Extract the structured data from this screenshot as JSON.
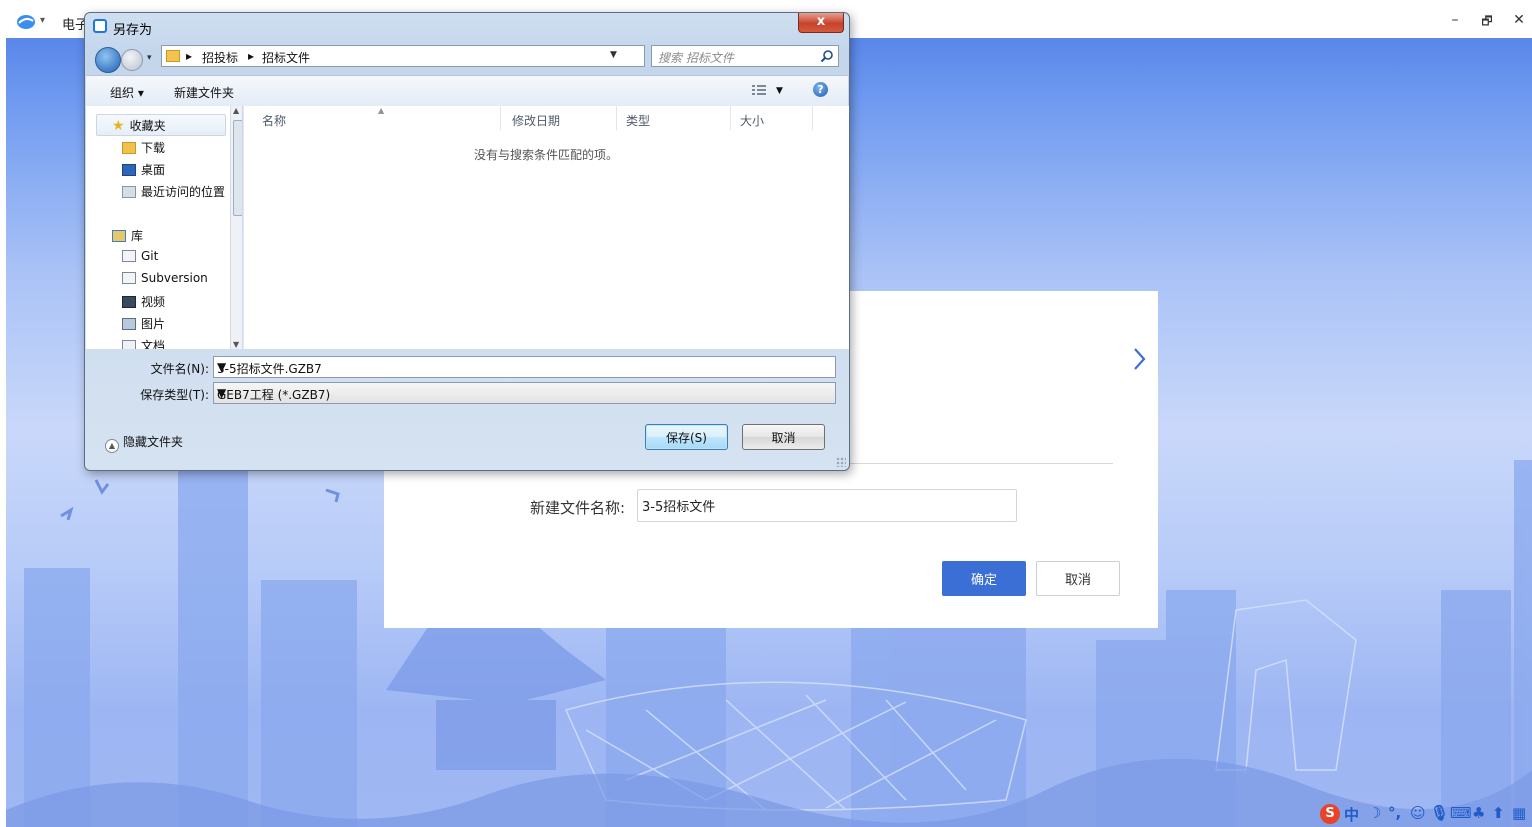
{
  "app": {
    "title": "电子",
    "window_controls": {
      "minimize": "–",
      "restore": "🗗",
      "close": "✕"
    }
  },
  "panel": {
    "next_icon": "chevron-right-icon",
    "new_file_label": "新建文件名称:",
    "new_file_value": "3-5招标文件",
    "ok_label": "确定",
    "cancel_label": "取消",
    "accent_color": "#3b6fd6"
  },
  "dialog": {
    "title": "另存为",
    "close_label": "x",
    "breadcrumb": [
      "招投标",
      "招标文件"
    ],
    "search_placeholder": "搜索 招标文件",
    "toolbar": {
      "organize": "组织 ▾",
      "new_folder": "新建文件夹",
      "help": "?"
    },
    "nav": {
      "favorites_label": "收藏夹",
      "favorites": [
        "下载",
        "桌面",
        "最近访问的位置"
      ],
      "libraries_label": "库",
      "libraries": [
        "Git",
        "Subversion",
        "视频",
        "图片",
        "文档"
      ]
    },
    "columns": [
      "名称",
      "修改日期",
      "类型",
      "大小"
    ],
    "empty_message": "没有与搜索条件匹配的项。",
    "filename_label": "文件名(N):",
    "filename_value": "3-5招标文件.GZB7",
    "filetype_label": "保存类型(T):",
    "filetype_value": "GEB7工程 (*.GZB7)",
    "hide_folders_label": "隐藏文件夹",
    "save_label": "保存(S)",
    "cancel_label": "取消"
  },
  "tray": {
    "ime_label": "中",
    "icons": [
      "sogou-icon",
      "moon-icon",
      "punctuation-icon",
      "emoji-icon",
      "microphone-icon",
      "keyboard-icon",
      "skin-icon",
      "shirt-icon",
      "grid-icon"
    ]
  }
}
